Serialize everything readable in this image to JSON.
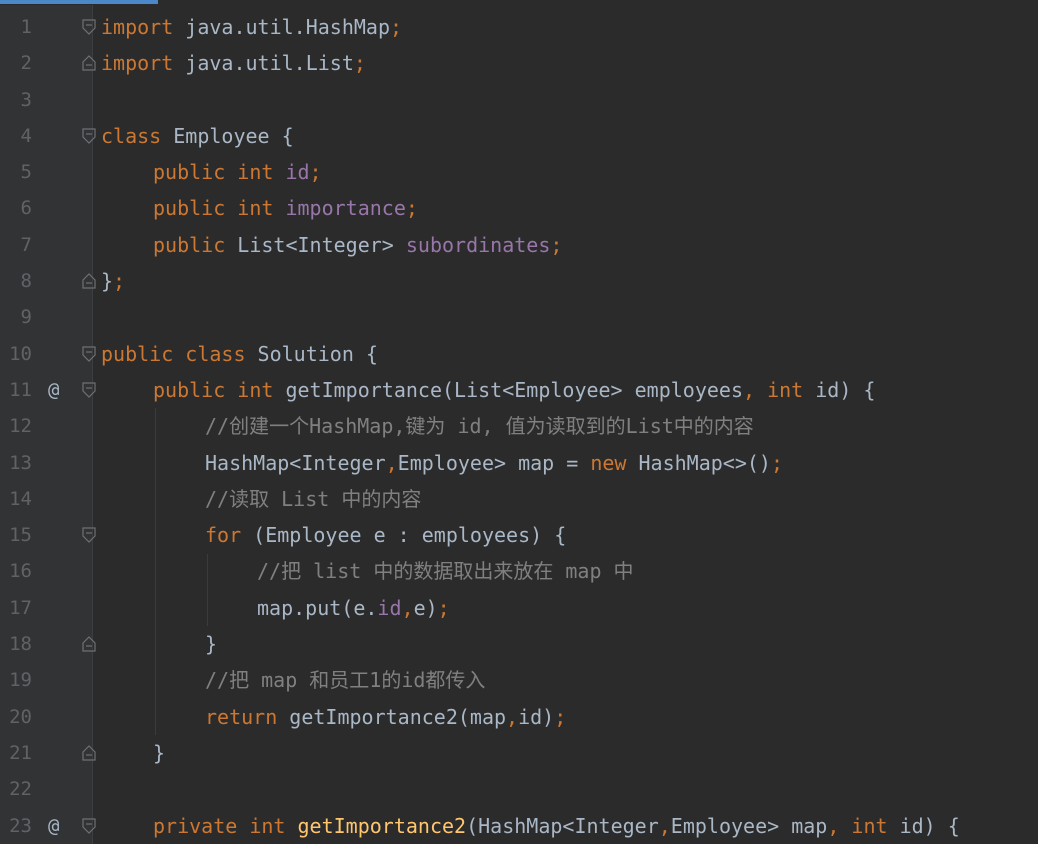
{
  "editor": {
    "lines": [
      {
        "num": "1",
        "marker": "",
        "fold": "open",
        "indent": 0,
        "tokens": [
          [
            "kw",
            "import"
          ],
          [
            "t",
            " java.util.HashMap"
          ],
          [
            "kw",
            ";"
          ]
        ]
      },
      {
        "num": "2",
        "marker": "",
        "fold": "close",
        "indent": 0,
        "tokens": [
          [
            "kw",
            "import"
          ],
          [
            "t",
            " java.util.List"
          ],
          [
            "kw",
            ";"
          ]
        ]
      },
      {
        "num": "3",
        "marker": "",
        "fold": "",
        "indent": 0,
        "tokens": []
      },
      {
        "num": "4",
        "marker": "",
        "fold": "open",
        "indent": 0,
        "tokens": [
          [
            "kw",
            "class"
          ],
          [
            "t",
            " Employee {"
          ]
        ]
      },
      {
        "num": "5",
        "marker": "",
        "fold": "",
        "indent": 4,
        "tokens": [
          [
            "kw",
            "public int "
          ],
          [
            "fld",
            "id"
          ],
          [
            "kw",
            ";"
          ]
        ]
      },
      {
        "num": "6",
        "marker": "",
        "fold": "",
        "indent": 4,
        "tokens": [
          [
            "kw",
            "public int "
          ],
          [
            "fld",
            "importance"
          ],
          [
            "kw",
            ";"
          ]
        ]
      },
      {
        "num": "7",
        "marker": "",
        "fold": "",
        "indent": 4,
        "tokens": [
          [
            "kw",
            "public "
          ],
          [
            "t",
            "List<Integer> "
          ],
          [
            "fld",
            "subordinates"
          ],
          [
            "kw",
            ";"
          ]
        ]
      },
      {
        "num": "8",
        "marker": "",
        "fold": "close",
        "indent": 0,
        "tokens": [
          [
            "t",
            "}"
          ],
          [
            "kw",
            ";"
          ]
        ]
      },
      {
        "num": "9",
        "marker": "",
        "fold": "",
        "indent": 0,
        "tokens": []
      },
      {
        "num": "10",
        "marker": "",
        "fold": "open",
        "indent": 0,
        "tokens": [
          [
            "kw",
            "public class "
          ],
          [
            "t",
            "Solution {"
          ]
        ]
      },
      {
        "num": "11",
        "marker": "@",
        "fold": "open",
        "indent": 4,
        "tokens": [
          [
            "kw",
            "public int "
          ],
          [
            "t",
            "getImportance(List<Employee> employees"
          ],
          [
            "kw",
            ", int "
          ],
          [
            "t",
            "id) {"
          ]
        ]
      },
      {
        "num": "12",
        "marker": "",
        "fold": "",
        "indent": 8,
        "tokens": [
          [
            "cmt",
            "//创建一个HashMap,键为 id, 值为读取到的List中的内容"
          ]
        ]
      },
      {
        "num": "13",
        "marker": "",
        "fold": "",
        "indent": 8,
        "tokens": [
          [
            "t",
            "HashMap<Integer"
          ],
          [
            "kw",
            ","
          ],
          [
            "t",
            "Employee> map = "
          ],
          [
            "kw",
            "new "
          ],
          [
            "t",
            "HashMap<>()"
          ],
          [
            "kw",
            ";"
          ]
        ]
      },
      {
        "num": "14",
        "marker": "",
        "fold": "",
        "indent": 8,
        "tokens": [
          [
            "cmt",
            "//读取 List 中的内容"
          ]
        ]
      },
      {
        "num": "15",
        "marker": "",
        "fold": "open",
        "indent": 8,
        "tokens": [
          [
            "kw",
            "for "
          ],
          [
            "t",
            "(Employee e : employees) {"
          ]
        ]
      },
      {
        "num": "16",
        "marker": "",
        "fold": "",
        "indent": 12,
        "tokens": [
          [
            "cmt",
            "//把 list 中的数据取出来放在 map 中"
          ]
        ]
      },
      {
        "num": "17",
        "marker": "",
        "fold": "",
        "indent": 12,
        "tokens": [
          [
            "t",
            "map.put(e."
          ],
          [
            "fld",
            "id"
          ],
          [
            "kw",
            ","
          ],
          [
            "t",
            "e)"
          ],
          [
            "kw",
            ";"
          ]
        ]
      },
      {
        "num": "18",
        "marker": "",
        "fold": "close",
        "indent": 8,
        "tokens": [
          [
            "t",
            "}"
          ]
        ]
      },
      {
        "num": "19",
        "marker": "",
        "fold": "",
        "indent": 8,
        "tokens": [
          [
            "cmt",
            "//把 map 和员工1的id都传入"
          ]
        ]
      },
      {
        "num": "20",
        "marker": "",
        "fold": "",
        "indent": 8,
        "tokens": [
          [
            "kw",
            "return "
          ],
          [
            "t",
            "getImportance2(map"
          ],
          [
            "kw",
            ","
          ],
          [
            "t",
            "id)"
          ],
          [
            "kw",
            ";"
          ]
        ]
      },
      {
        "num": "21",
        "marker": "",
        "fold": "close",
        "indent": 4,
        "tokens": [
          [
            "t",
            "}"
          ]
        ]
      },
      {
        "num": "22",
        "marker": "",
        "fold": "",
        "indent": 0,
        "tokens": []
      },
      {
        "num": "23",
        "marker": "@",
        "fold": "open",
        "indent": 4,
        "tokens": [
          [
            "kw",
            "private int "
          ],
          [
            "fn",
            "getImportance2"
          ],
          [
            "t",
            "(HashMap<Integer"
          ],
          [
            "kw",
            ","
          ],
          [
            "t",
            "Employee> map"
          ],
          [
            "kw",
            ", int "
          ],
          [
            "t",
            "id) {"
          ]
        ]
      }
    ]
  },
  "colors": {
    "background": "#2b2b2b",
    "keyword": "#cc7832",
    "field": "#9876aa",
    "comment": "#808080",
    "method_decl": "#ffc66d",
    "text": "#a9b7c6"
  }
}
